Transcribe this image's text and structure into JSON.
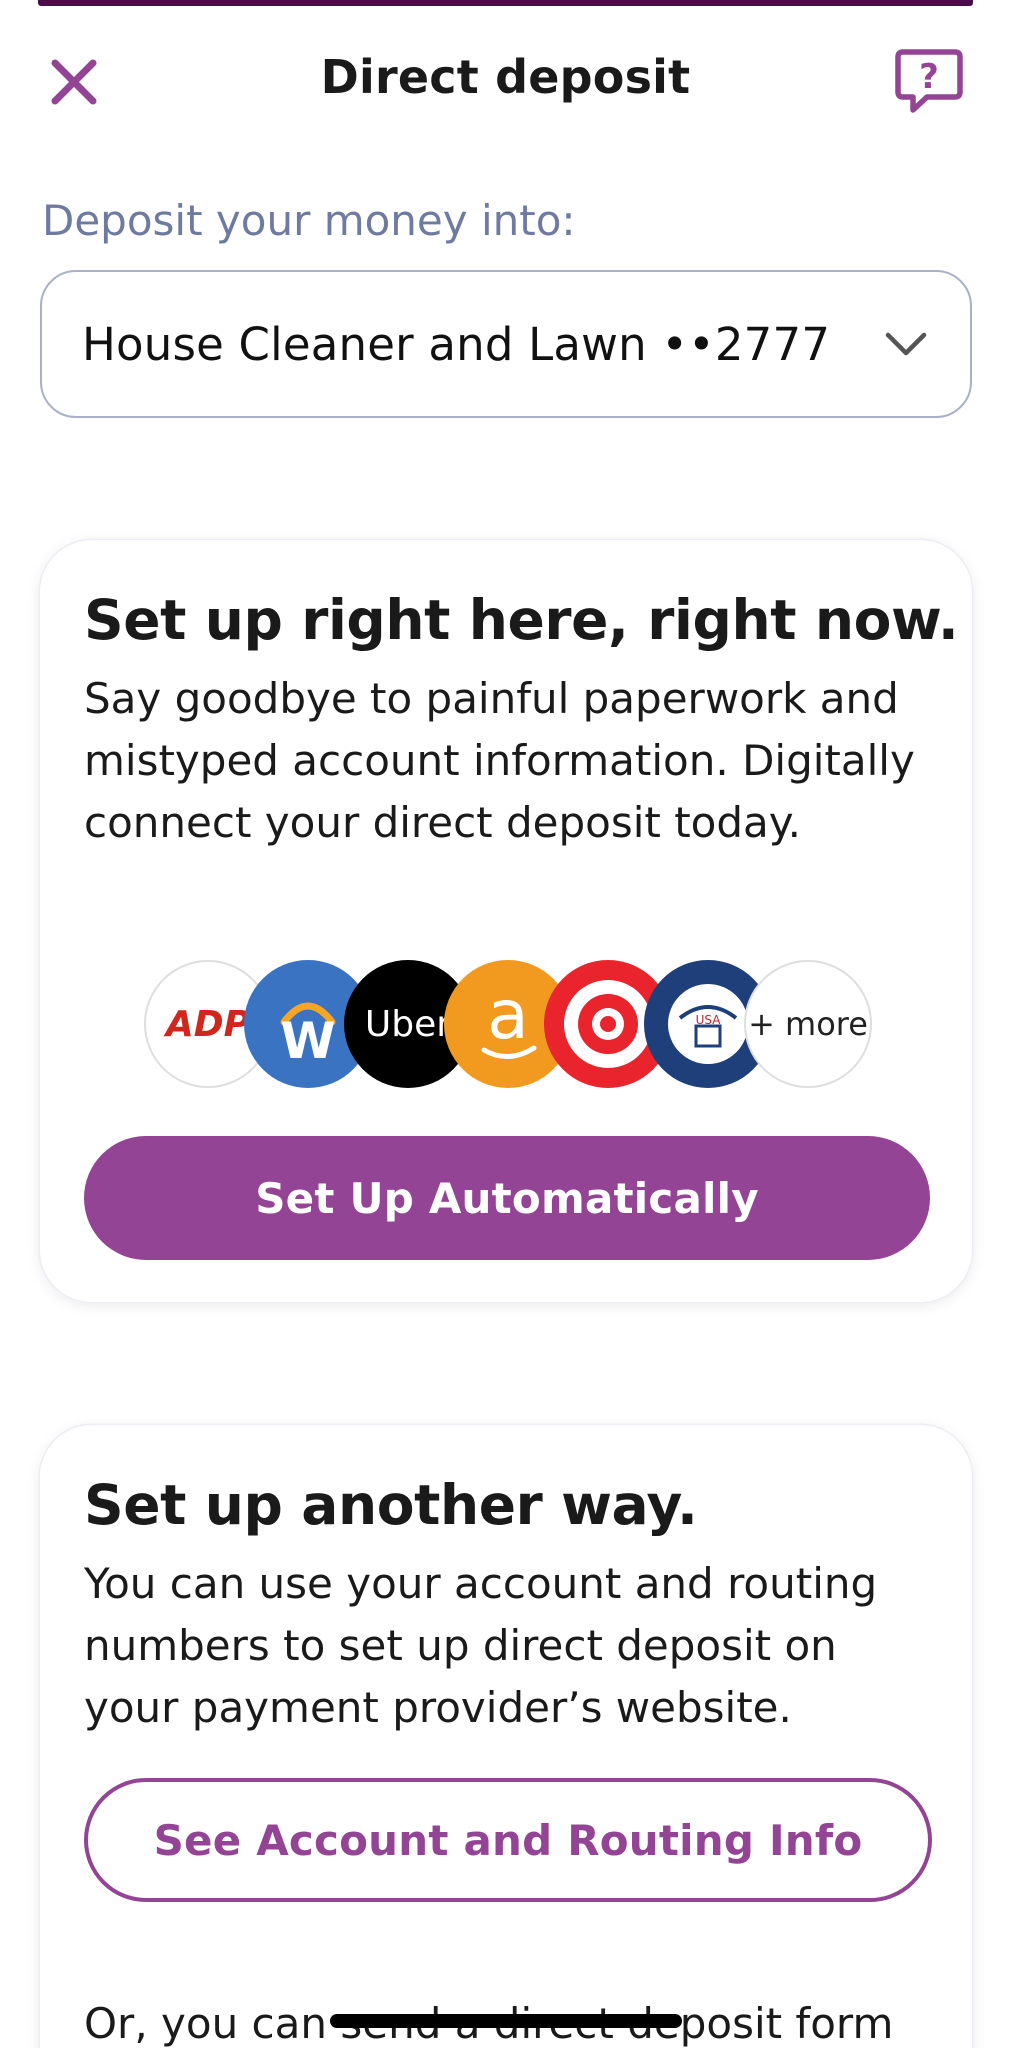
{
  "header": {
    "title": "Direct deposit",
    "close_icon": "close-icon",
    "help_icon": "help-chat-icon"
  },
  "deposit": {
    "label": "Deposit your money into:",
    "account_name": "House Cleaner and Lawn ••2777"
  },
  "card_auto": {
    "title": "Set up right here, right now.",
    "body": "Say goodbye to painful paperwork and mistyped account information. Digitally connect your direct deposit today.",
    "logos": [
      {
        "name": "ADP",
        "label": "ADP"
      },
      {
        "name": "Workday",
        "label": "W"
      },
      {
        "name": "Uber",
        "label": "Uber"
      },
      {
        "name": "Amazon",
        "label": "a"
      },
      {
        "name": "Target",
        "label": ""
      },
      {
        "name": "Social Security Administration",
        "label": "USA"
      },
      {
        "name": "More",
        "label": "+ more"
      }
    ],
    "button_label": "Set Up Automatically"
  },
  "card_manual": {
    "title": "Set up another way.",
    "body": "You can use your account and routing numbers to set up direct deposit on your payment provider’s website.",
    "button_label": "See Account and Routing Info",
    "footer_text": "Or, you can send a direct deposit form"
  },
  "colors": {
    "accent": "#944494",
    "label": "#6f7aa0",
    "text": "#1a1a1a"
  }
}
